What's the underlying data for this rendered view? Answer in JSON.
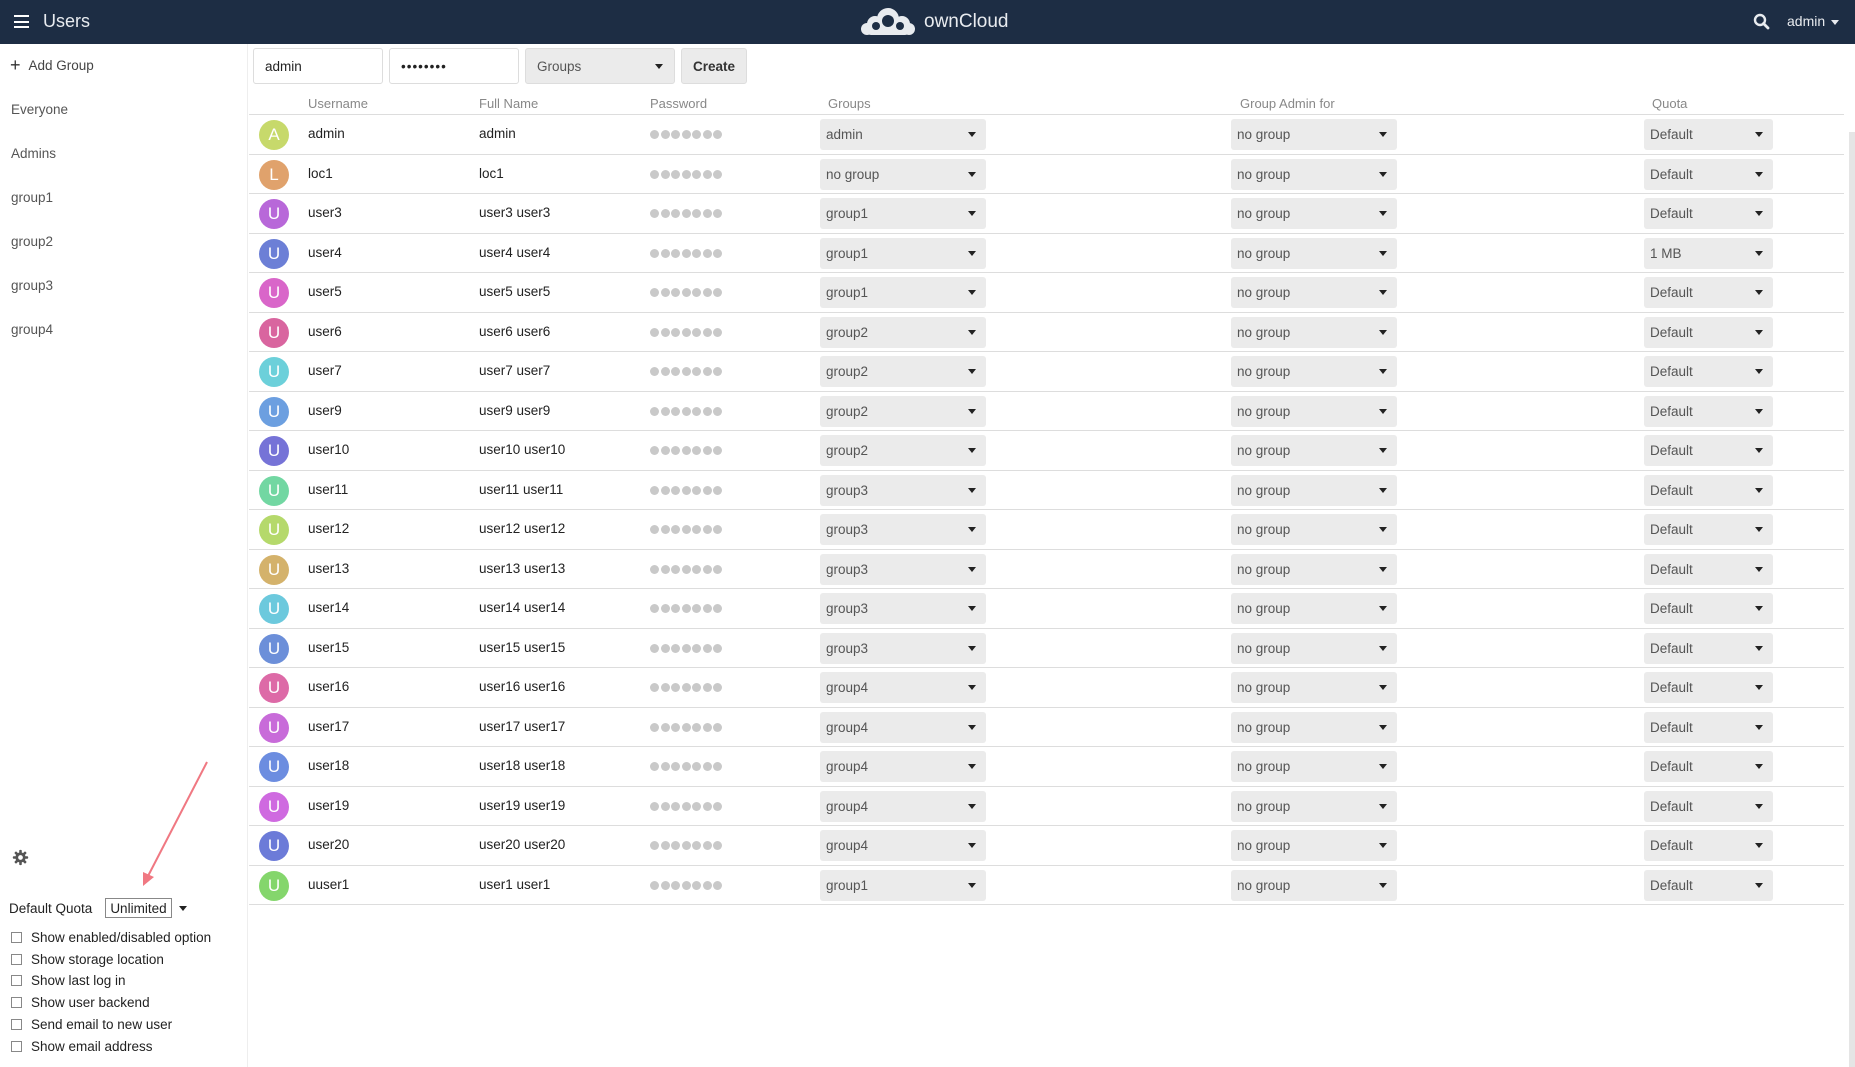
{
  "header": {
    "app_title": "Users",
    "brand": "ownCloud",
    "user_menu": "admin",
    "bg_color": "#1d2d44"
  },
  "sidebar": {
    "add_group": "Add Group",
    "groups": [
      "Everyone",
      "Admins",
      "group1",
      "group2",
      "group3",
      "group4"
    ],
    "default_quota_label": "Default Quota",
    "default_quota_value": "Unlimited",
    "options": [
      "Show enabled/disabled option",
      "Show storage location",
      "Show last log in",
      "Show user backend",
      "Send email to new user",
      "Show email address"
    ]
  },
  "new_user": {
    "username_value": "admin",
    "password_value": "••••••••",
    "groups_placeholder": "Groups",
    "create_label": "Create"
  },
  "table": {
    "headers": [
      "Username",
      "Full Name",
      "Password",
      "Groups",
      "Group Admin for",
      "Quota"
    ],
    "rows": [
      {
        "initial": "A",
        "color": "#c7d96b",
        "username": "admin",
        "fullname": "admin",
        "groups": "admin",
        "admin_for": "no group",
        "quota": "Default"
      },
      {
        "initial": "L",
        "color": "#e0a26c",
        "username": "loc1",
        "fullname": "loc1",
        "groups": "no group",
        "admin_for": "no group",
        "quota": "Default"
      },
      {
        "initial": "U",
        "color": "#b868d9",
        "username": "user3",
        "fullname": "user3 user3",
        "groups": "group1",
        "admin_for": "no group",
        "quota": "Default"
      },
      {
        "initial": "U",
        "color": "#6c7fd6",
        "username": "user4",
        "fullname": "user4 user4",
        "groups": "group1",
        "admin_for": "no group",
        "quota": "1 MB"
      },
      {
        "initial": "U",
        "color": "#d966c9",
        "username": "user5",
        "fullname": "user5 user5",
        "groups": "group1",
        "admin_for": "no group",
        "quota": "Default"
      },
      {
        "initial": "U",
        "color": "#d9659f",
        "username": "user6",
        "fullname": "user6 user6",
        "groups": "group2",
        "admin_for": "no group",
        "quota": "Default"
      },
      {
        "initial": "U",
        "color": "#6cd0da",
        "username": "user7",
        "fullname": "user7 user7",
        "groups": "group2",
        "admin_for": "no group",
        "quota": "Default"
      },
      {
        "initial": "U",
        "color": "#6c9fe0",
        "username": "user9",
        "fullname": "user9 user9",
        "groups": "group2",
        "admin_for": "no group",
        "quota": "Default"
      },
      {
        "initial": "U",
        "color": "#7673d7",
        "username": "user10",
        "fullname": "user10 user10",
        "groups": "group2",
        "admin_for": "no group",
        "quota": "Default"
      },
      {
        "initial": "U",
        "color": "#72d7a2",
        "username": "user11",
        "fullname": "user11 user11",
        "groups": "group3",
        "admin_for": "no group",
        "quota": "Default"
      },
      {
        "initial": "U",
        "color": "#b5d96b",
        "username": "user12",
        "fullname": "user12 user12",
        "groups": "group3",
        "admin_for": "no group",
        "quota": "Default"
      },
      {
        "initial": "U",
        "color": "#d4b26b",
        "username": "user13",
        "fullname": "user13 user13",
        "groups": "group3",
        "admin_for": "no group",
        "quota": "Default"
      },
      {
        "initial": "U",
        "color": "#6cc9dd",
        "username": "user14",
        "fullname": "user14 user14",
        "groups": "group3",
        "admin_for": "no group",
        "quota": "Default"
      },
      {
        "initial": "U",
        "color": "#6c8fd9",
        "username": "user15",
        "fullname": "user15 user15",
        "groups": "group3",
        "admin_for": "no group",
        "quota": "Default"
      },
      {
        "initial": "U",
        "color": "#dd6aa7",
        "username": "user16",
        "fullname": "user16 user16",
        "groups": "group4",
        "admin_for": "no group",
        "quota": "Default"
      },
      {
        "initial": "U",
        "color": "#c86bd9",
        "username": "user17",
        "fullname": "user17 user17",
        "groups": "group4",
        "admin_for": "no group",
        "quota": "Default"
      },
      {
        "initial": "U",
        "color": "#6c8de0",
        "username": "user18",
        "fullname": "user18 user18",
        "groups": "group4",
        "admin_for": "no group",
        "quota": "Default"
      },
      {
        "initial": "U",
        "color": "#cf6ae0",
        "username": "user19",
        "fullname": "user19 user19",
        "groups": "group4",
        "admin_for": "no group",
        "quota": "Default"
      },
      {
        "initial": "U",
        "color": "#6c7bd8",
        "username": "user20",
        "fullname": "user20 user20",
        "groups": "group4",
        "admin_for": "no group",
        "quota": "Default"
      },
      {
        "initial": "U",
        "color": "#84d66c",
        "username": "uuser1",
        "fullname": "user1 user1",
        "groups": "group1",
        "admin_for": "no group",
        "quota": "Default"
      }
    ]
  },
  "annotation_color": "#f07882"
}
